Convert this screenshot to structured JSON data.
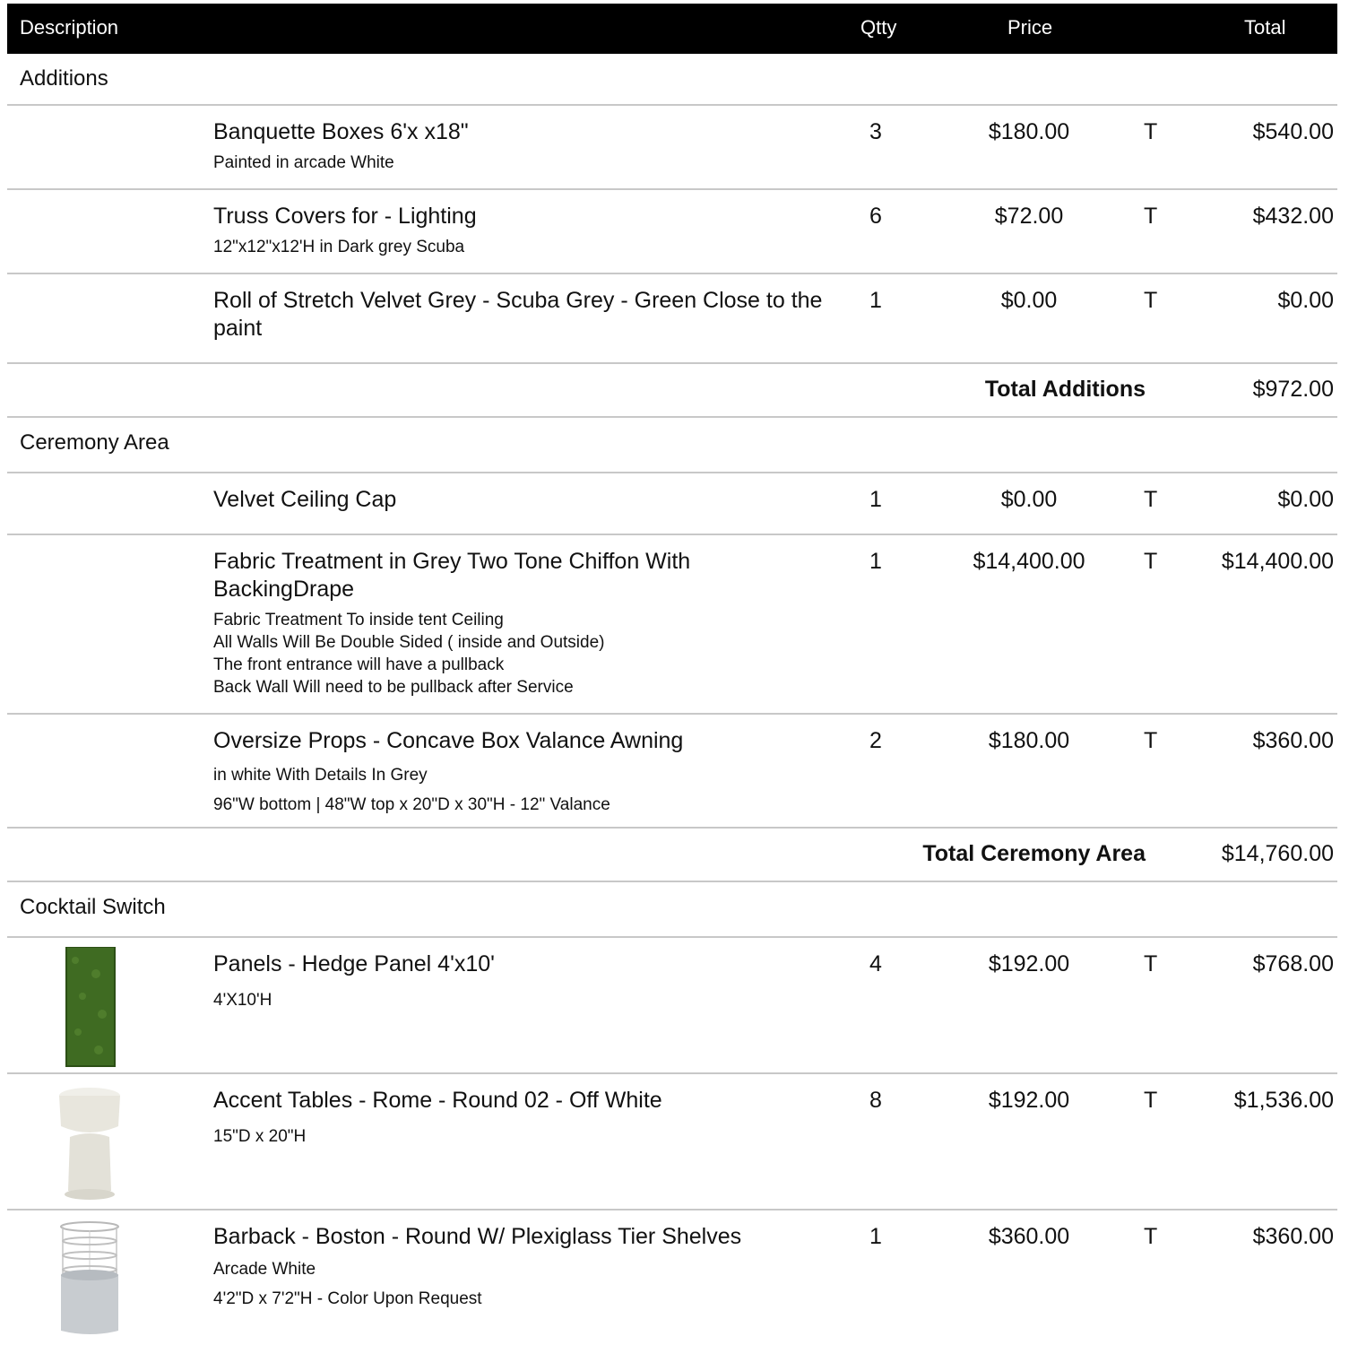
{
  "header": {
    "description": "Description",
    "qty": "Qtty",
    "price": "Price",
    "total": "Total"
  },
  "sections": [
    {
      "title": "Additions",
      "items": [
        {
          "name": "Banquette Boxes  6'x x18\"",
          "notes": [
            "Painted in arcade White"
          ],
          "qty": "3",
          "price": "$180.00",
          "tax": "T",
          "total": "$540.00"
        },
        {
          "name": "Truss Covers for - Lighting",
          "notes": [
            "12\"x12\"x12'H in Dark grey Scuba"
          ],
          "qty": "6",
          "price": "$72.00",
          "tax": "T",
          "total": "$432.00"
        },
        {
          "name": "Roll of Stretch Velvet Grey - Scuba Grey - Green Close to the paint",
          "notes": [],
          "qty": "1",
          "price": "$0.00",
          "tax": "T",
          "total": "$0.00"
        }
      ],
      "subtotal_label": "Total Additions",
      "subtotal": "$972.00"
    },
    {
      "title": "Ceremony Area",
      "items": [
        {
          "name": "Velvet Ceiling Cap",
          "notes": [],
          "qty": "1",
          "price": "$0.00",
          "tax": "T",
          "total": "$0.00"
        },
        {
          "name": "Fabric Treatment in Grey Two Tone Chiffon With BackingDrape",
          "notes": [
            "Fabric Treatment To inside tent Ceiling",
            "All Walls Will Be Double Sided ( inside and Outside)",
            "The front entrance will have a pullback",
            "Back Wall Will need to be pullback after Service"
          ],
          "qty": "1",
          "price": "$14,400.00",
          "tax": "T",
          "total": "$14,400.00"
        },
        {
          "name": "Oversize Props - Concave Box Valance Awning",
          "notes": [
            "in white With Details In Grey",
            "96\"W bottom | 48\"W top x 20\"D x 30\"H - 12\" Valance"
          ],
          "qty": "2",
          "price": "$180.00",
          "tax": "T",
          "total": "$360.00"
        }
      ],
      "subtotal_label": "Total Ceremony Area",
      "subtotal": "$14,760.00"
    },
    {
      "title": "Cocktail Switch",
      "items": [
        {
          "name": "Panels - Hedge Panel 4'x10'",
          "notes": [
            "4'X10'H"
          ],
          "qty": "4",
          "price": "$192.00",
          "tax": "T",
          "total": "$768.00",
          "image": "hedge-panel"
        },
        {
          "name": "Accent Tables - Rome - Round 02 - Off White",
          "notes": [
            "15\"D x 20\"H"
          ],
          "qty": "8",
          "price": "$192.00",
          "tax": "T",
          "total": "$1,536.00",
          "image": "accent-table"
        },
        {
          "name": "Barback - Boston - Round W/ Plexiglass Tier Shelves",
          "notes": [
            "Arcade White",
            "4'2\"D x 7'2\"H - Color Upon Request"
          ],
          "qty": "1",
          "price": "$360.00",
          "tax": "T",
          "total": "$360.00",
          "image": "barback"
        }
      ]
    }
  ]
}
